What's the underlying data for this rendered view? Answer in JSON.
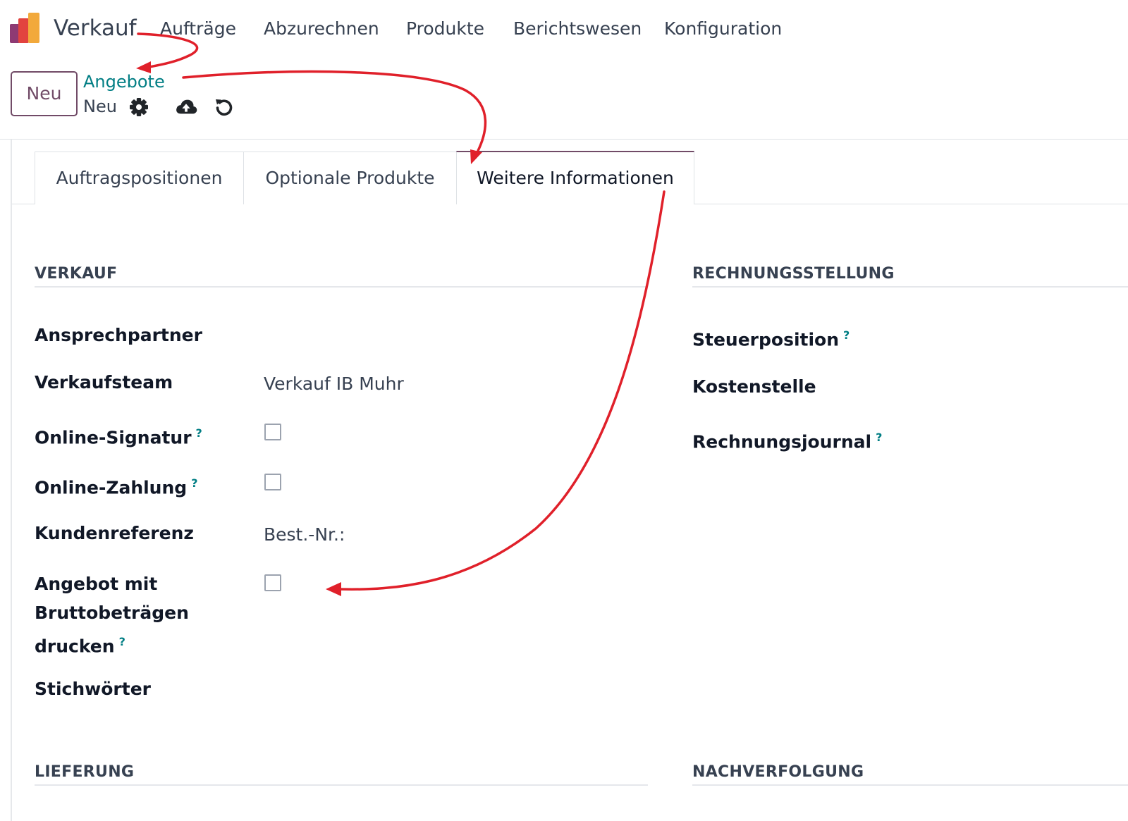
{
  "navbar": {
    "app_name": "Verkauf",
    "menu": [
      "Aufträge",
      "Abzurechnen",
      "Produkte",
      "Berichtswesen",
      "Konfiguration"
    ]
  },
  "control_panel": {
    "new_button": "Neu",
    "breadcrumb_parent": "Angebote",
    "breadcrumb_current": "Neu",
    "icons": [
      "gear-icon",
      "cloud-upload-icon",
      "undo-icon"
    ]
  },
  "tabs": [
    {
      "label": "Auftragspositionen",
      "active": false
    },
    {
      "label": "Optionale Produkte",
      "active": false
    },
    {
      "label": "Weitere Informationen",
      "active": true
    }
  ],
  "sections": {
    "verkauf": {
      "title": "VERKAUF",
      "fields": {
        "ansprechpartner": {
          "label": "Ansprechpartner"
        },
        "verkaufsteam": {
          "label": "Verkaufsteam",
          "value": "Verkauf IB Muhr"
        },
        "online_signatur": {
          "label": "Online-Signatur",
          "help": "?",
          "checked": false
        },
        "online_zahlung": {
          "label": "Online-Zahlung",
          "help": "?",
          "checked": false
        },
        "kundenreferenz": {
          "label": "Kundenreferenz",
          "value": "Best.-Nr.:"
        },
        "angebot_brutto": {
          "label_lines": [
            "Angebot mit",
            "Bruttobeträgen",
            "drucken"
          ],
          "help": "?",
          "checked": false
        },
        "stichwoerter": {
          "label": "Stichwörter"
        }
      }
    },
    "rechnungsstellung": {
      "title": "RECHNUNGSSTELLUNG",
      "fields": {
        "steuerposition": {
          "label": "Steuerposition",
          "help": "?"
        },
        "kostenstelle": {
          "label": "Kostenstelle"
        },
        "rechnungsjournal": {
          "label": "Rechnungsjournal",
          "help": "?"
        }
      }
    },
    "lieferung": {
      "title": "LIEFERUNG"
    },
    "nachverfolgung": {
      "title": "NACHVERFOLGUNG"
    }
  },
  "colors": {
    "brand": "#714B67",
    "link": "#017e84",
    "annotation": "#e0202a"
  }
}
